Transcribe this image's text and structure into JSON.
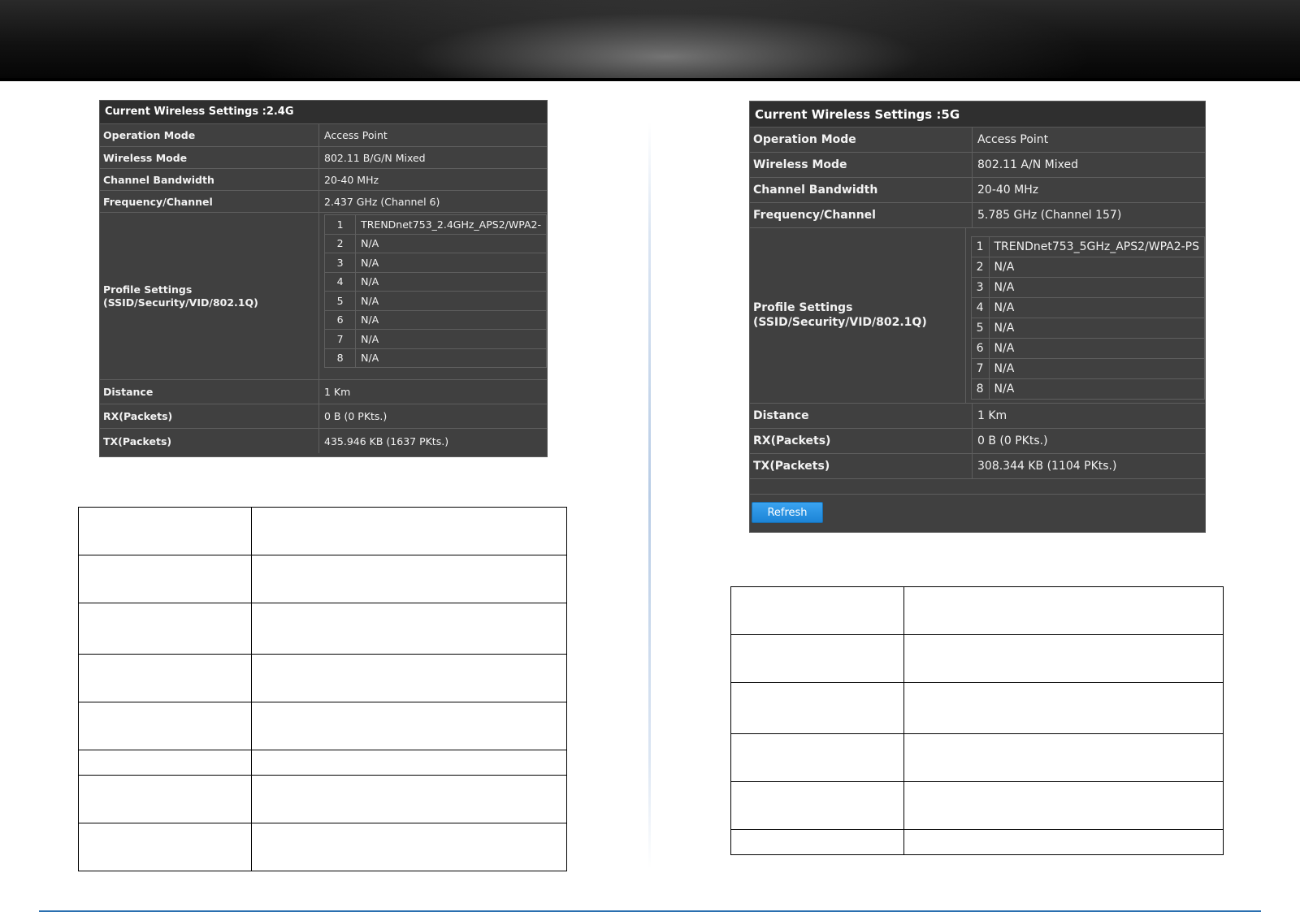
{
  "panel_24": {
    "title": "Current Wireless Settings :2.4G",
    "operation_mode_label": "Operation Mode",
    "operation_mode_value": "Access Point",
    "wireless_mode_label": "Wireless Mode",
    "wireless_mode_value": "802.11 B/G/N Mixed",
    "channel_bandwidth_label": "Channel Bandwidth",
    "channel_bandwidth_value": "20-40 MHz",
    "frequency_label": "Frequency/Channel",
    "frequency_value": "2.437 GHz (Channel 6)",
    "profile_label": "Profile Settings\n(SSID/Security/VID/802.1Q)",
    "profiles": [
      {
        "idx": "1",
        "value": "TRENDnet753_2.4GHz_APS2/WPA2-"
      },
      {
        "idx": "2",
        "value": "N/A"
      },
      {
        "idx": "3",
        "value": "N/A"
      },
      {
        "idx": "4",
        "value": "N/A"
      },
      {
        "idx": "5",
        "value": "N/A"
      },
      {
        "idx": "6",
        "value": "N/A"
      },
      {
        "idx": "7",
        "value": "N/A"
      },
      {
        "idx": "8",
        "value": "N/A"
      }
    ],
    "distance_label": "Distance",
    "distance_value": "1 Km",
    "rx_label": "RX(Packets)",
    "rx_value": "0 B (0 PKts.)",
    "tx_label": "TX(Packets)",
    "tx_value": "435.946 KB (1637 PKts.)"
  },
  "panel_5": {
    "title": "Current Wireless Settings :5G",
    "operation_mode_label": "Operation Mode",
    "operation_mode_value": "Access Point",
    "wireless_mode_label": "Wireless Mode",
    "wireless_mode_value": "802.11 A/N Mixed",
    "channel_bandwidth_label": "Channel Bandwidth",
    "channel_bandwidth_value": "20-40 MHz",
    "frequency_label": "Frequency/Channel",
    "frequency_value": "5.785 GHz (Channel 157)",
    "profile_label": "Profile Settings\n(SSID/Security/VID/802.1Q)",
    "profiles": [
      {
        "idx": "1",
        "value": "TRENDnet753_5GHz_APS2/WPA2-PS"
      },
      {
        "idx": "2",
        "value": "N/A"
      },
      {
        "idx": "3",
        "value": "N/A"
      },
      {
        "idx": "4",
        "value": "N/A"
      },
      {
        "idx": "5",
        "value": "N/A"
      },
      {
        "idx": "6",
        "value": "N/A"
      },
      {
        "idx": "7",
        "value": "N/A"
      },
      {
        "idx": "8",
        "value": "N/A"
      }
    ],
    "distance_label": "Distance",
    "distance_value": "1 Km",
    "rx_label": "RX(Packets)",
    "rx_value": "0 B (0 PKts.)",
    "tx_label": "TX(Packets)",
    "tx_value": "308.344 KB (1104 PKts.)",
    "refresh_label": "Refresh"
  },
  "colors": {
    "panel_bg": "#404040",
    "title_bg": "#2f2f2f",
    "refresh_button": "#1c84d6",
    "footer_line": "#2a6fb0"
  }
}
